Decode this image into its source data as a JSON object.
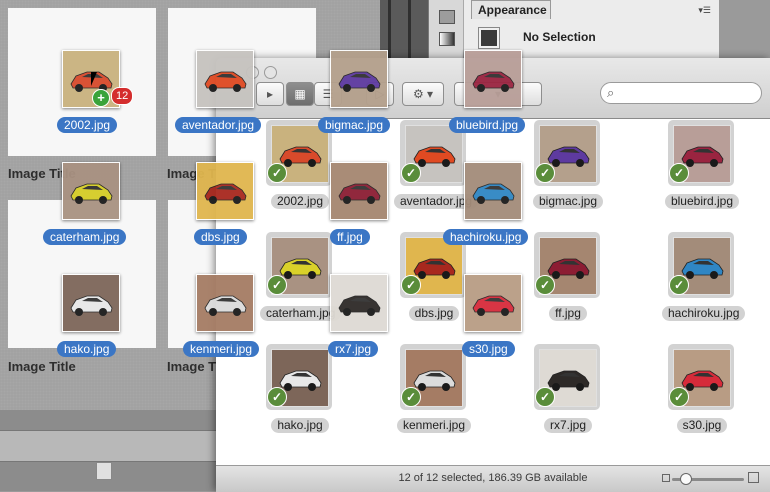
{
  "window": {
    "status_text": "12 of 12 selected, 186.39 GB available"
  },
  "appearance": {
    "tab_label": "Appearance",
    "selection_label": "No Selection"
  },
  "layout_cards": {
    "caption": "Image Title",
    "clipped_caption": "Image Ti"
  },
  "items": [
    {
      "name": "2002.jpg",
      "color": "#d84a2b",
      "bg": "#c9b27e"
    },
    {
      "name": "aventador.jpg",
      "color": "#e04a22",
      "bg": "#c6c3bf"
    },
    {
      "name": "bigmac.jpg",
      "color": "#5e3aa0",
      "bg": "#b4a08c"
    },
    {
      "name": "bluebird.jpg",
      "color": "#9a2440",
      "bg": "#b89e98"
    },
    {
      "name": "caterham.jpg",
      "color": "#d9d12a",
      "bg": "#a99282"
    },
    {
      "name": "dbs.jpg",
      "color": "#a8281e",
      "bg": "#e0b64e"
    },
    {
      "name": "ff.jpg",
      "color": "#8c1d33",
      "bg": "#a58670"
    },
    {
      "name": "hachiroku.jpg",
      "color": "#2f86c4",
      "bg": "#a38c7a"
    },
    {
      "name": "hako.jpg",
      "color": "#e8e8e8",
      "bg": "#7d6659"
    },
    {
      "name": "kenmeri.jpg",
      "color": "#dcdcdc",
      "bg": "#a57c64"
    },
    {
      "name": "rx7.jpg",
      "color": "#2e2a28",
      "bg": "#dedad4"
    },
    {
      "name": "s30.jpg",
      "color": "#d62b3a",
      "bg": "#b89c84"
    }
  ],
  "drag": {
    "count": "12",
    "plus": "+"
  },
  "icons": {
    "check": "✓",
    "search": "⌕",
    "gear": "⚙",
    "grid": "▦",
    "list": "☰",
    "cover": "▷"
  }
}
